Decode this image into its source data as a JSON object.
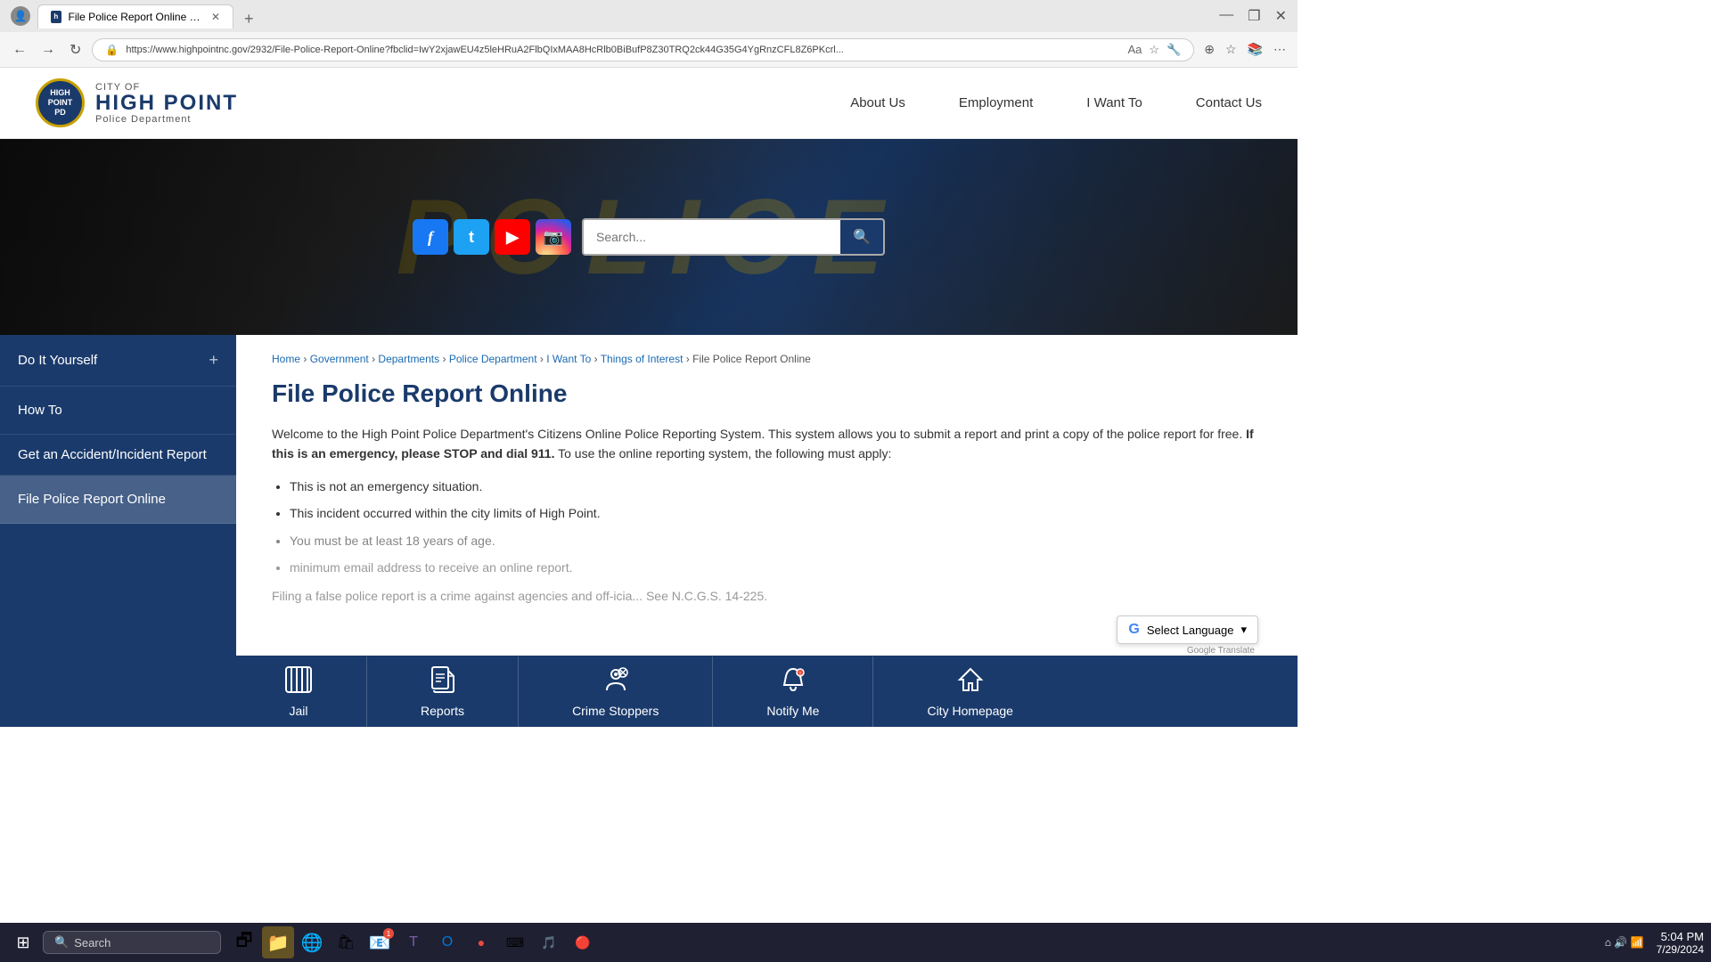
{
  "browser": {
    "tab_title": "File Police Report Online | High ...",
    "favicon_label": "h",
    "url": "https://www.highpointnc.gov/2932/File-Police-Report-Online?fbclid=IwY2xjawEU4z5leHRuA2FlbQIxMAA8HcRlb0BiBufP8Z30TRQ2ck44G35G4YgRnzCFL8Z6PKcrl...",
    "close_icon": "✕",
    "new_tab_icon": "+",
    "back_icon": "←",
    "forward_icon": "→",
    "refresh_icon": "↻",
    "search_icon": "🔍"
  },
  "site": {
    "logo": {
      "city_of": "City of",
      "high_point": "HIGH POINT",
      "police_dept": "Police Department"
    },
    "nav": {
      "about": "About Us",
      "employment": "Employment",
      "i_want_to": "I Want To",
      "contact": "Contact Us"
    },
    "search": {
      "placeholder": "Search...",
      "button_label": "🔍"
    },
    "social": {
      "facebook": "f",
      "twitter": "t",
      "youtube": "▶",
      "instagram": "📷"
    }
  },
  "sidebar": {
    "items": [
      {
        "label": "Do It Yourself",
        "has_plus": true,
        "active": false
      },
      {
        "label": "How To",
        "has_plus": false,
        "active": false
      },
      {
        "label": "Get an Accident/Incident Report",
        "has_plus": false,
        "active": false
      },
      {
        "label": "File Police Report Online",
        "has_plus": false,
        "active": true,
        "current": true
      }
    ]
  },
  "breadcrumb": {
    "items": [
      "Home",
      "Government",
      "Departments",
      "Police Department",
      "I Want To",
      "Things of Interest",
      "File Police Report Online"
    ]
  },
  "page": {
    "title": "File Police Report Online",
    "body_intro": "Welcome to the High Point Police Department's Citizens Online Police Reporting System. This system allows you to submit a report and print a copy of the police report for free.",
    "emergency_warning": "If this is an emergency, please STOP and dial 911.",
    "body_requirements": "To use the online reporting system, the following must apply:",
    "bullets": [
      "This is not an emergency situation.",
      "This incident occurred within the city limits of High Point.",
      "You must be at least 18 years of age.",
      "minimum email address to receive an online report.",
      "Filing a false police report is a crime against agencies and off-icia... See N.C.G.S. 14-225."
    ]
  },
  "translate": {
    "g_label": "G",
    "label": "Select Language",
    "dropdown": "▾",
    "credit": "Google Translate"
  },
  "footer": {
    "items": [
      {
        "icon": "⊞",
        "label": "Jail",
        "icon_type": "jail"
      },
      {
        "icon": "📁",
        "label": "Reports",
        "icon_type": "reports"
      },
      {
        "icon": "🔍",
        "label": "Crime Stoppers",
        "icon_type": "crime-stoppers"
      },
      {
        "icon": "🔔",
        "label": "Notify Me",
        "icon_type": "notify-me"
      },
      {
        "icon": "🏠",
        "label": "City Homepage",
        "icon_type": "city-homepage"
      }
    ]
  },
  "taskbar": {
    "start_icon": "⊞",
    "search_placeholder": "Search",
    "icons": [
      {
        "name": "task-view",
        "symbol": "🗗"
      },
      {
        "name": "file-explorer",
        "symbol": "📁",
        "active": true
      },
      {
        "name": "edge",
        "symbol": "🌐"
      },
      {
        "name": "store",
        "symbol": "🛍"
      },
      {
        "name": "mail",
        "symbol": "📧",
        "badge": "1"
      },
      {
        "name": "teams",
        "symbol": "💬"
      },
      {
        "name": "outlook",
        "symbol": "📮"
      },
      {
        "name": "app1",
        "symbol": "📋"
      },
      {
        "name": "terminal",
        "symbol": "⌨"
      },
      {
        "name": "app2",
        "symbol": "🎵"
      },
      {
        "name": "app3",
        "symbol": "🔴"
      }
    ],
    "time": "5:04 PM",
    "date": "7/29/2024"
  }
}
